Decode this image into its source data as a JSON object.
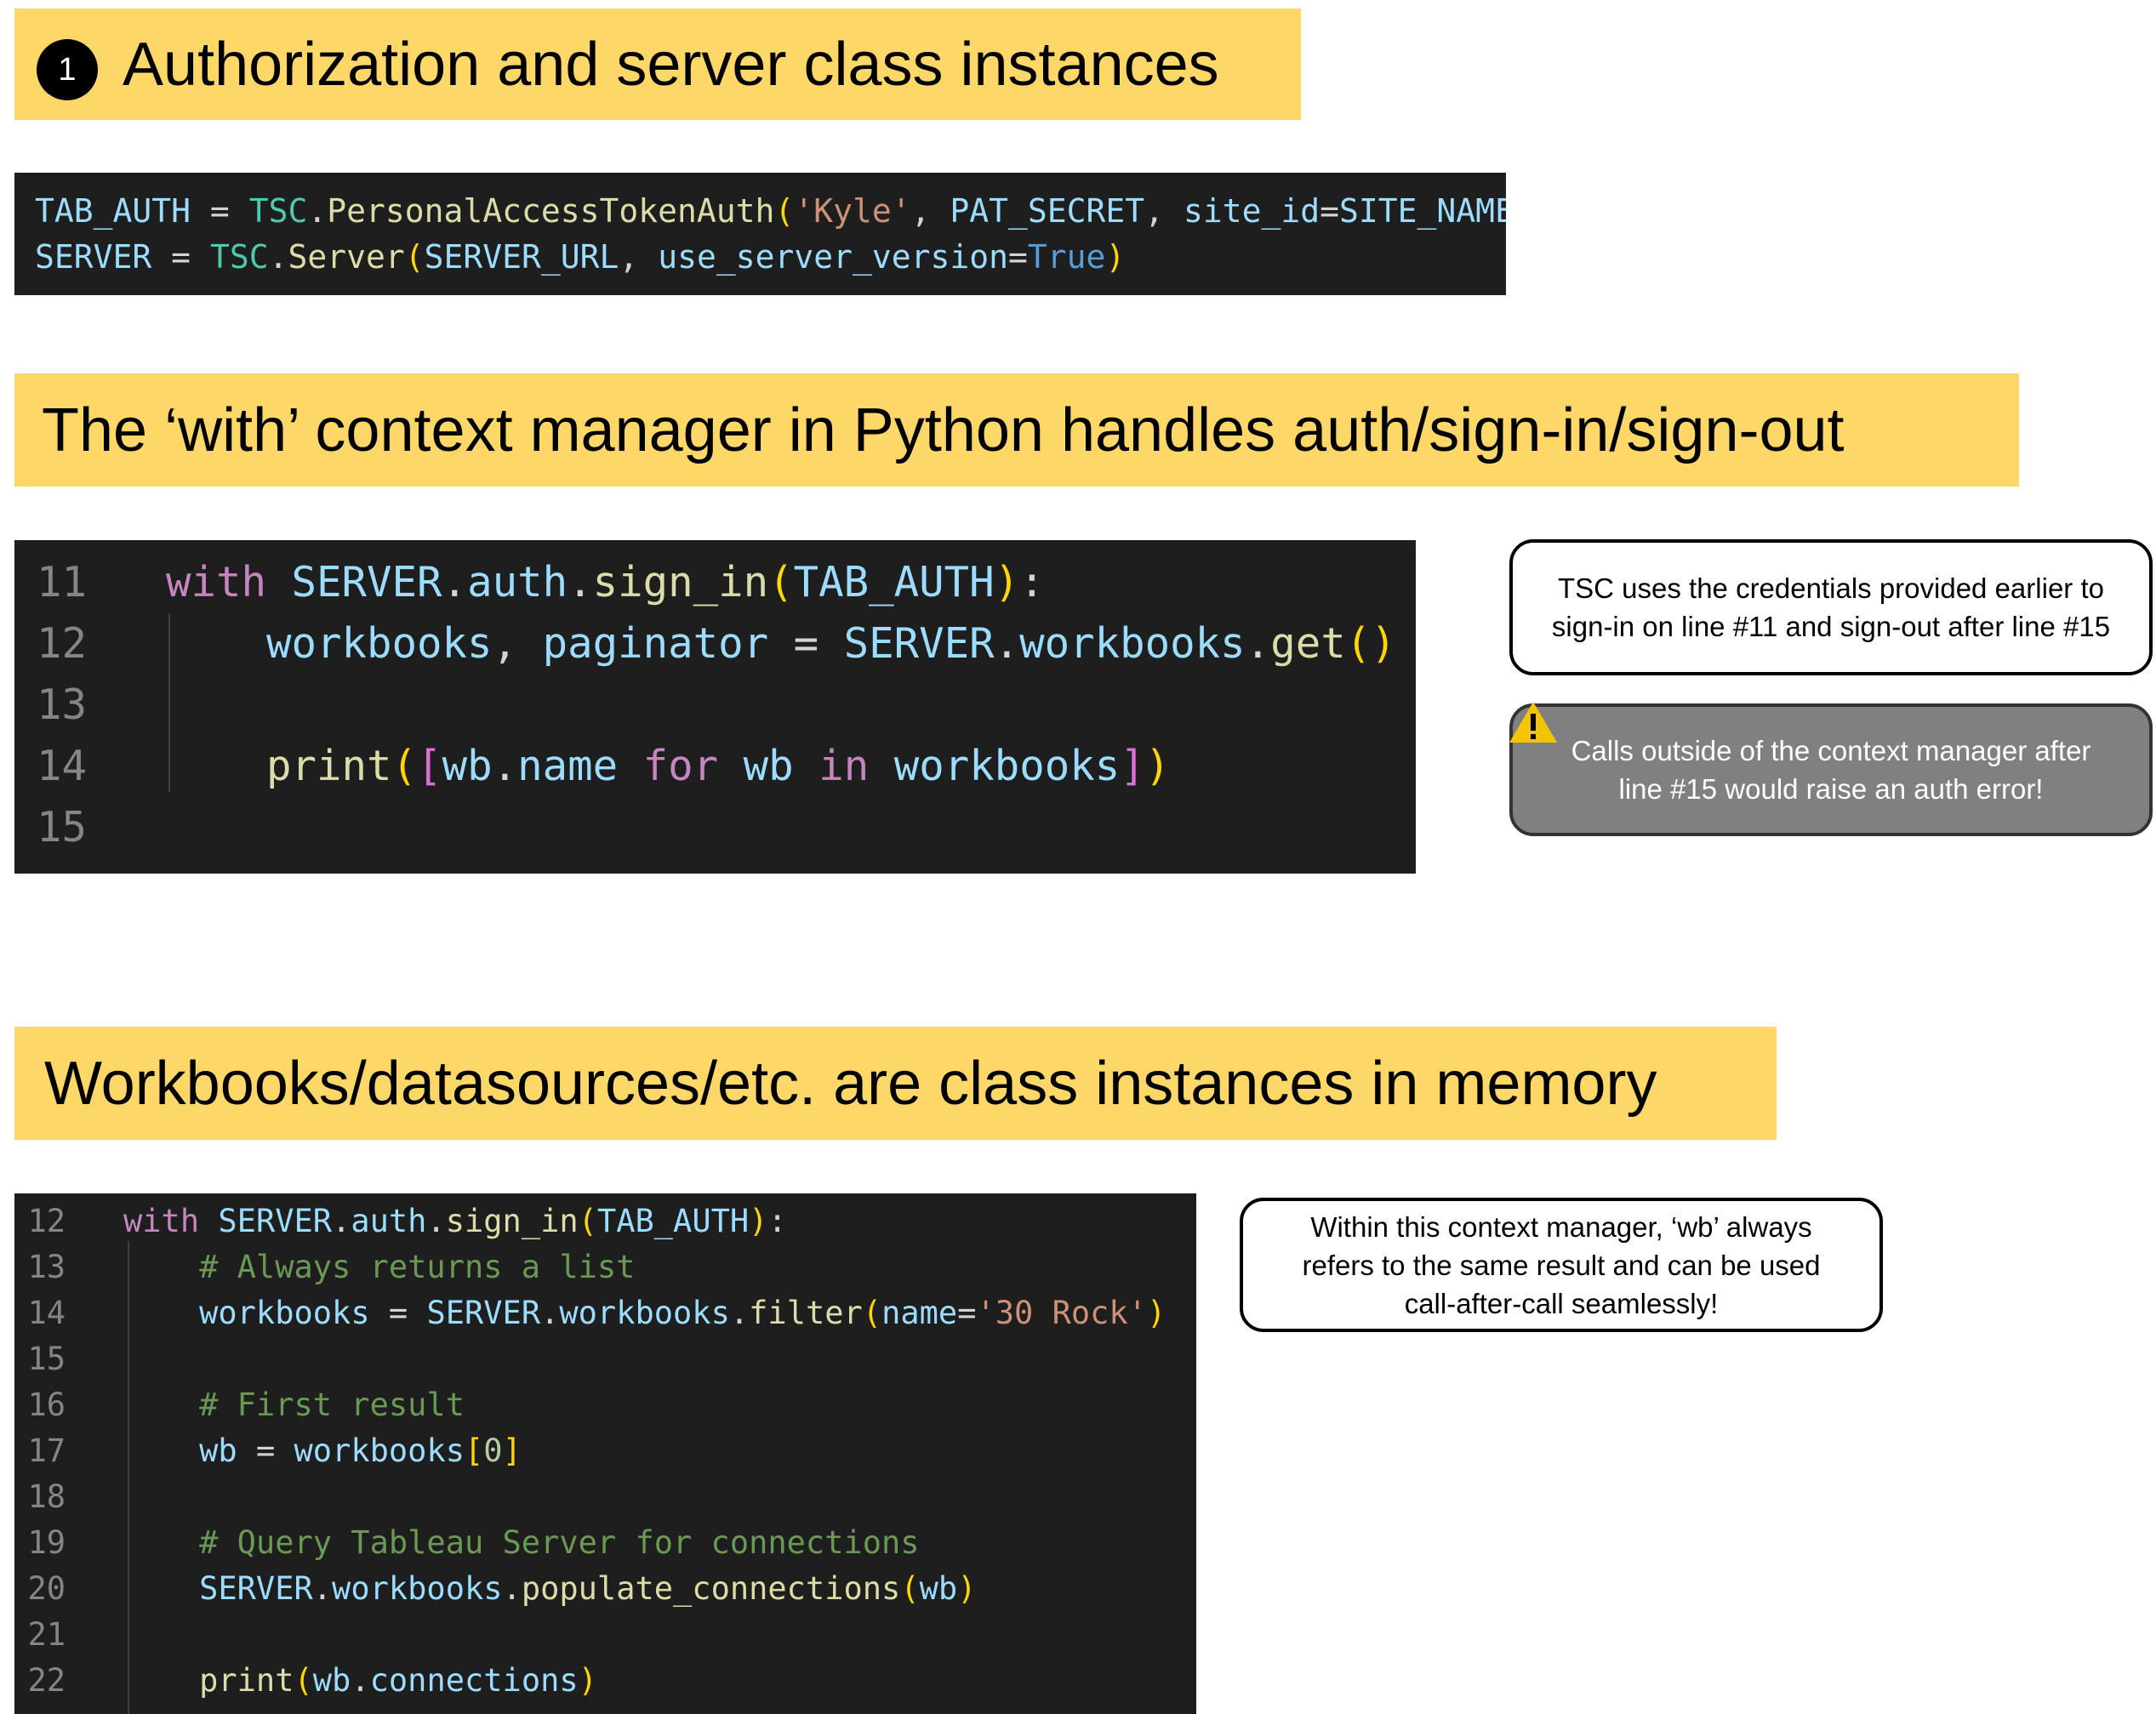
{
  "sections": [
    {
      "badge": "1",
      "title": "Authorization and server class instances"
    },
    {
      "title": "The ‘with’ context manager in Python handles auth/sign-in/sign-out"
    },
    {
      "title": "Workbooks/datasources/etc. are class instances in memory"
    }
  ],
  "code_block_1": {
    "lines": [
      "TAB_AUTH = TSC.PersonalAccessTokenAuth('Kyle', PAT_SECRET, site_id=SITE_NAME)",
      "SERVER = TSC.Server(SERVER_URL, use_server_version=True)"
    ]
  },
  "code_block_2": {
    "lines": [
      {
        "num": "11",
        "code": "with SERVER.auth.sign_in(TAB_AUTH):"
      },
      {
        "num": "12",
        "code": "    workbooks, paginator = SERVER.workbooks.get()"
      },
      {
        "num": "13",
        "code": ""
      },
      {
        "num": "14",
        "code": "    print([wb.name for wb in workbooks])"
      },
      {
        "num": "15",
        "code": ""
      }
    ]
  },
  "code_block_3": {
    "lines": [
      {
        "num": "12",
        "code": "with SERVER.auth.sign_in(TAB_AUTH):"
      },
      {
        "num": "13",
        "code": "    # Always returns a list"
      },
      {
        "num": "14",
        "code": "    workbooks = SERVER.workbooks.filter(name='30 Rock')"
      },
      {
        "num": "15",
        "code": ""
      },
      {
        "num": "16",
        "code": "    # First result"
      },
      {
        "num": "17",
        "code": "    wb = workbooks[0]"
      },
      {
        "num": "18",
        "code": ""
      },
      {
        "num": "19",
        "code": "    # Query Tableau Server for connections"
      },
      {
        "num": "20",
        "code": "    SERVER.workbooks.populate_connections(wb)"
      },
      {
        "num": "21",
        "code": ""
      },
      {
        "num": "22",
        "code": "    print(wb.connections)"
      }
    ]
  },
  "notes": {
    "credentials_line1": "TSC uses the credentials provided earlier to",
    "credentials_line2": "sign-in on line #11 and sign-out after line #15",
    "warning_line1": "Calls outside of the context manager after",
    "warning_line2": "line #15 would raise an auth error!",
    "warning_icon": "warning-triangle-icon",
    "wb_line1": "Within this context manager, ‘wb’ always",
    "wb_line2": "refers to the same result and can be used",
    "wb_line3": "call-after-call seamlessly!"
  },
  "colors": {
    "banner": "#fdd869",
    "code_background": "#1e1e1e",
    "warning_note": "#808080",
    "warning_icon": "#f5c400"
  }
}
